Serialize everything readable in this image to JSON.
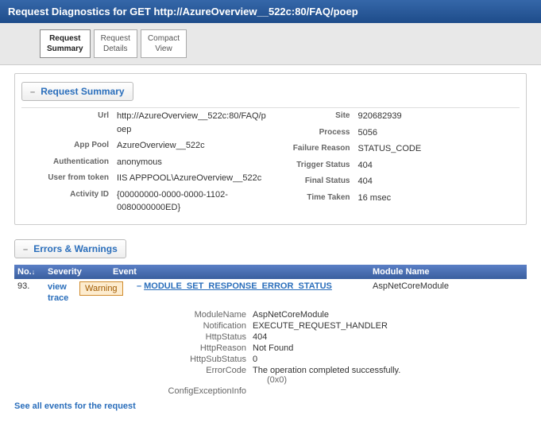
{
  "title": "Request Diagnostics for GET http://AzureOverview__522c:80/FAQ/poep",
  "tabs": [
    {
      "l1": "Request",
      "l2": "Summary",
      "active": true
    },
    {
      "l1": "Request",
      "l2": "Details",
      "active": false
    },
    {
      "l1": "Compact",
      "l2": "View",
      "active": false
    }
  ],
  "sections": {
    "summary": {
      "toggle": "–",
      "title": "Request Summary"
    },
    "errors": {
      "toggle": "–",
      "title": "Errors & Warnings"
    }
  },
  "summary": {
    "left": {
      "Url": "http://AzureOverview__522c:80/FAQ/poep",
      "App_Pool": "AzureOverview__522c",
      "Authentication": "anonymous",
      "User_from_token": "IIS APPPOOL\\AzureOverview__522c",
      "Activity_ID": "{00000000-0000-0000-1102-0080000000ED}"
    },
    "leftLabels": {
      "Url": "Url",
      "App_Pool": "App Pool",
      "Authentication": "Authentication",
      "User_from_token": "User from token",
      "Activity_ID": "Activity ID"
    },
    "right": {
      "Site": "920682939",
      "Process": "5056",
      "Failure_Reason": "STATUS_CODE",
      "Trigger_Status": "404",
      "Final_Status": "404",
      "Time_Taken": "16 msec"
    },
    "rightLabels": {
      "Site": "Site",
      "Process": "Process",
      "Failure_Reason": "Failure Reason",
      "Trigger_Status": "Trigger Status",
      "Final_Status": "Final Status",
      "Time_Taken": "Time Taken"
    }
  },
  "errhdr": {
    "no": "No.",
    "arrow": "↓",
    "sev": "Severity",
    "ev": "Event",
    "mod": "Module Name"
  },
  "err": {
    "no": "93.",
    "view": "view trace",
    "sev": "Warning",
    "toggle": "–",
    "event": "MODULE_SET_RESPONSE_ERROR_STATUS",
    "module": "AspNetCoreModule"
  },
  "details": [
    {
      "l": "ModuleName",
      "v": "AspNetCoreModule"
    },
    {
      "l": "Notification",
      "v": "EXECUTE_REQUEST_HANDLER"
    },
    {
      "l": "HttpStatus",
      "v": "404"
    },
    {
      "l": "HttpReason",
      "v": "Not Found"
    },
    {
      "l": "HttpSubStatus",
      "v": "0"
    },
    {
      "l": "ErrorCode",
      "v": "The operation completed successfully.",
      "sub": "(0x0)"
    },
    {
      "l": "ConfigExceptionInfo",
      "v": ""
    }
  ],
  "seeall": "See all events for the request"
}
